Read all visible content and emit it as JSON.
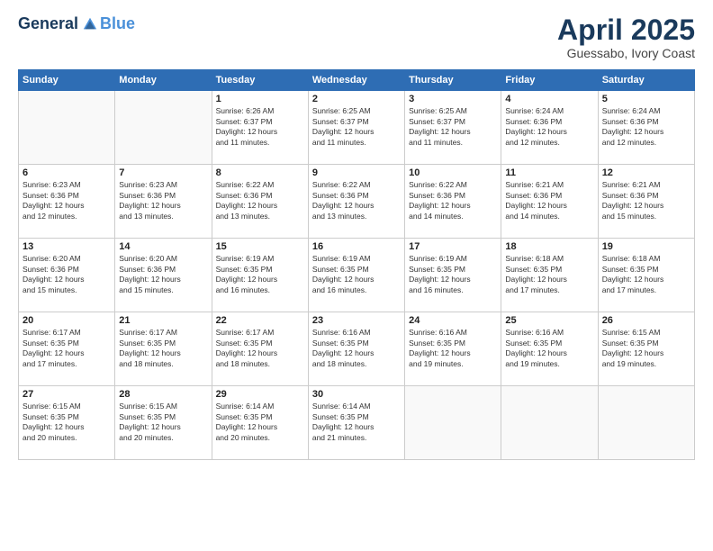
{
  "header": {
    "logo_general": "General",
    "logo_blue": "Blue",
    "title": "April 2025",
    "subtitle": "Guessabo, Ivory Coast"
  },
  "days_of_week": [
    "Sunday",
    "Monday",
    "Tuesday",
    "Wednesday",
    "Thursday",
    "Friday",
    "Saturday"
  ],
  "weeks": [
    [
      {
        "day": "",
        "info": ""
      },
      {
        "day": "",
        "info": ""
      },
      {
        "day": "1",
        "info": "Sunrise: 6:26 AM\nSunset: 6:37 PM\nDaylight: 12 hours\nand 11 minutes."
      },
      {
        "day": "2",
        "info": "Sunrise: 6:25 AM\nSunset: 6:37 PM\nDaylight: 12 hours\nand 11 minutes."
      },
      {
        "day": "3",
        "info": "Sunrise: 6:25 AM\nSunset: 6:37 PM\nDaylight: 12 hours\nand 11 minutes."
      },
      {
        "day": "4",
        "info": "Sunrise: 6:24 AM\nSunset: 6:36 PM\nDaylight: 12 hours\nand 12 minutes."
      },
      {
        "day": "5",
        "info": "Sunrise: 6:24 AM\nSunset: 6:36 PM\nDaylight: 12 hours\nand 12 minutes."
      }
    ],
    [
      {
        "day": "6",
        "info": "Sunrise: 6:23 AM\nSunset: 6:36 PM\nDaylight: 12 hours\nand 12 minutes."
      },
      {
        "day": "7",
        "info": "Sunrise: 6:23 AM\nSunset: 6:36 PM\nDaylight: 12 hours\nand 13 minutes."
      },
      {
        "day": "8",
        "info": "Sunrise: 6:22 AM\nSunset: 6:36 PM\nDaylight: 12 hours\nand 13 minutes."
      },
      {
        "day": "9",
        "info": "Sunrise: 6:22 AM\nSunset: 6:36 PM\nDaylight: 12 hours\nand 13 minutes."
      },
      {
        "day": "10",
        "info": "Sunrise: 6:22 AM\nSunset: 6:36 PM\nDaylight: 12 hours\nand 14 minutes."
      },
      {
        "day": "11",
        "info": "Sunrise: 6:21 AM\nSunset: 6:36 PM\nDaylight: 12 hours\nand 14 minutes."
      },
      {
        "day": "12",
        "info": "Sunrise: 6:21 AM\nSunset: 6:36 PM\nDaylight: 12 hours\nand 15 minutes."
      }
    ],
    [
      {
        "day": "13",
        "info": "Sunrise: 6:20 AM\nSunset: 6:36 PM\nDaylight: 12 hours\nand 15 minutes."
      },
      {
        "day": "14",
        "info": "Sunrise: 6:20 AM\nSunset: 6:36 PM\nDaylight: 12 hours\nand 15 minutes."
      },
      {
        "day": "15",
        "info": "Sunrise: 6:19 AM\nSunset: 6:35 PM\nDaylight: 12 hours\nand 16 minutes."
      },
      {
        "day": "16",
        "info": "Sunrise: 6:19 AM\nSunset: 6:35 PM\nDaylight: 12 hours\nand 16 minutes."
      },
      {
        "day": "17",
        "info": "Sunrise: 6:19 AM\nSunset: 6:35 PM\nDaylight: 12 hours\nand 16 minutes."
      },
      {
        "day": "18",
        "info": "Sunrise: 6:18 AM\nSunset: 6:35 PM\nDaylight: 12 hours\nand 17 minutes."
      },
      {
        "day": "19",
        "info": "Sunrise: 6:18 AM\nSunset: 6:35 PM\nDaylight: 12 hours\nand 17 minutes."
      }
    ],
    [
      {
        "day": "20",
        "info": "Sunrise: 6:17 AM\nSunset: 6:35 PM\nDaylight: 12 hours\nand 17 minutes."
      },
      {
        "day": "21",
        "info": "Sunrise: 6:17 AM\nSunset: 6:35 PM\nDaylight: 12 hours\nand 18 minutes."
      },
      {
        "day": "22",
        "info": "Sunrise: 6:17 AM\nSunset: 6:35 PM\nDaylight: 12 hours\nand 18 minutes."
      },
      {
        "day": "23",
        "info": "Sunrise: 6:16 AM\nSunset: 6:35 PM\nDaylight: 12 hours\nand 18 minutes."
      },
      {
        "day": "24",
        "info": "Sunrise: 6:16 AM\nSunset: 6:35 PM\nDaylight: 12 hours\nand 19 minutes."
      },
      {
        "day": "25",
        "info": "Sunrise: 6:16 AM\nSunset: 6:35 PM\nDaylight: 12 hours\nand 19 minutes."
      },
      {
        "day": "26",
        "info": "Sunrise: 6:15 AM\nSunset: 6:35 PM\nDaylight: 12 hours\nand 19 minutes."
      }
    ],
    [
      {
        "day": "27",
        "info": "Sunrise: 6:15 AM\nSunset: 6:35 PM\nDaylight: 12 hours\nand 20 minutes."
      },
      {
        "day": "28",
        "info": "Sunrise: 6:15 AM\nSunset: 6:35 PM\nDaylight: 12 hours\nand 20 minutes."
      },
      {
        "day": "29",
        "info": "Sunrise: 6:14 AM\nSunset: 6:35 PM\nDaylight: 12 hours\nand 20 minutes."
      },
      {
        "day": "30",
        "info": "Sunrise: 6:14 AM\nSunset: 6:35 PM\nDaylight: 12 hours\nand 21 minutes."
      },
      {
        "day": "",
        "info": ""
      },
      {
        "day": "",
        "info": ""
      },
      {
        "day": "",
        "info": ""
      }
    ]
  ]
}
